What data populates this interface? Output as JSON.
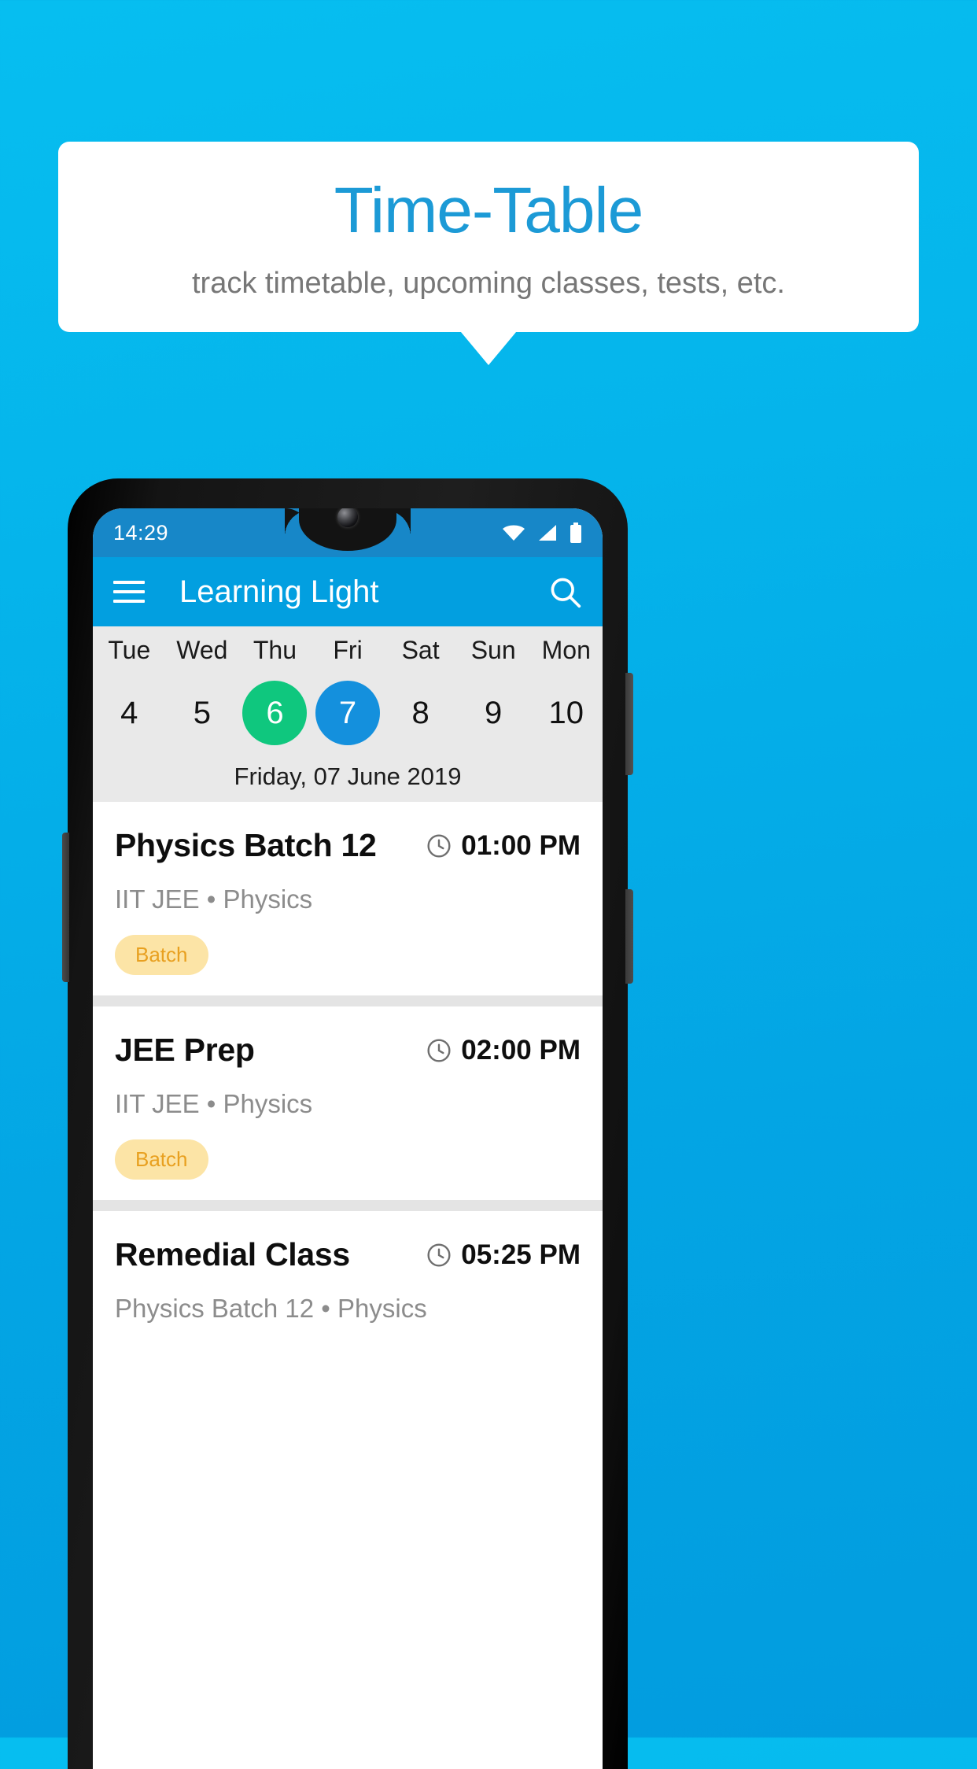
{
  "promo": {
    "title": "Time-Table",
    "subtitle": "track timetable, upcoming classes, tests, etc.",
    "title_color": "#1C9AD6",
    "background_color": "#05B4EB"
  },
  "phone": {
    "status_bar": {
      "time": "14:29",
      "icons": [
        "wifi-icon",
        "signal-icon",
        "battery-icon"
      ],
      "background_color": "#1787C8"
    },
    "app_bar": {
      "menu_icon": "hamburger-menu-icon",
      "title": "Learning Light",
      "search_icon": "search-icon",
      "background_color": "#029FE0"
    },
    "date_strip": {
      "days": [
        {
          "name": "Tue",
          "number": "4",
          "state": "normal"
        },
        {
          "name": "Wed",
          "number": "5",
          "state": "normal"
        },
        {
          "name": "Thu",
          "number": "6",
          "state": "today"
        },
        {
          "name": "Fri",
          "number": "7",
          "state": "selected"
        },
        {
          "name": "Sat",
          "number": "8",
          "state": "normal"
        },
        {
          "name": "Sun",
          "number": "9",
          "state": "normal"
        },
        {
          "name": "Mon",
          "number": "10",
          "state": "normal"
        }
      ],
      "today_color": "#0FC77E",
      "selected_color": "#1490DD",
      "selected_date_label": "Friday, 07 June 2019",
      "background_color": "#E9E9E9"
    },
    "events": [
      {
        "title": "Physics Batch 12",
        "time": "01:00 PM",
        "subtitle": "IIT JEE • Physics",
        "badge": "Batch",
        "clock_icon": "clock-icon"
      },
      {
        "title": "JEE Prep",
        "time": "02:00 PM",
        "subtitle": "IIT JEE • Physics",
        "badge": "Batch",
        "clock_icon": "clock-icon"
      },
      {
        "title": "Remedial Class",
        "time": "05:25 PM",
        "subtitle": "Physics Batch 12 • Physics",
        "badge": "",
        "clock_icon": "clock-icon"
      }
    ],
    "badge_colors": {
      "background": "#FCE4A6",
      "text": "#E8A020"
    }
  }
}
